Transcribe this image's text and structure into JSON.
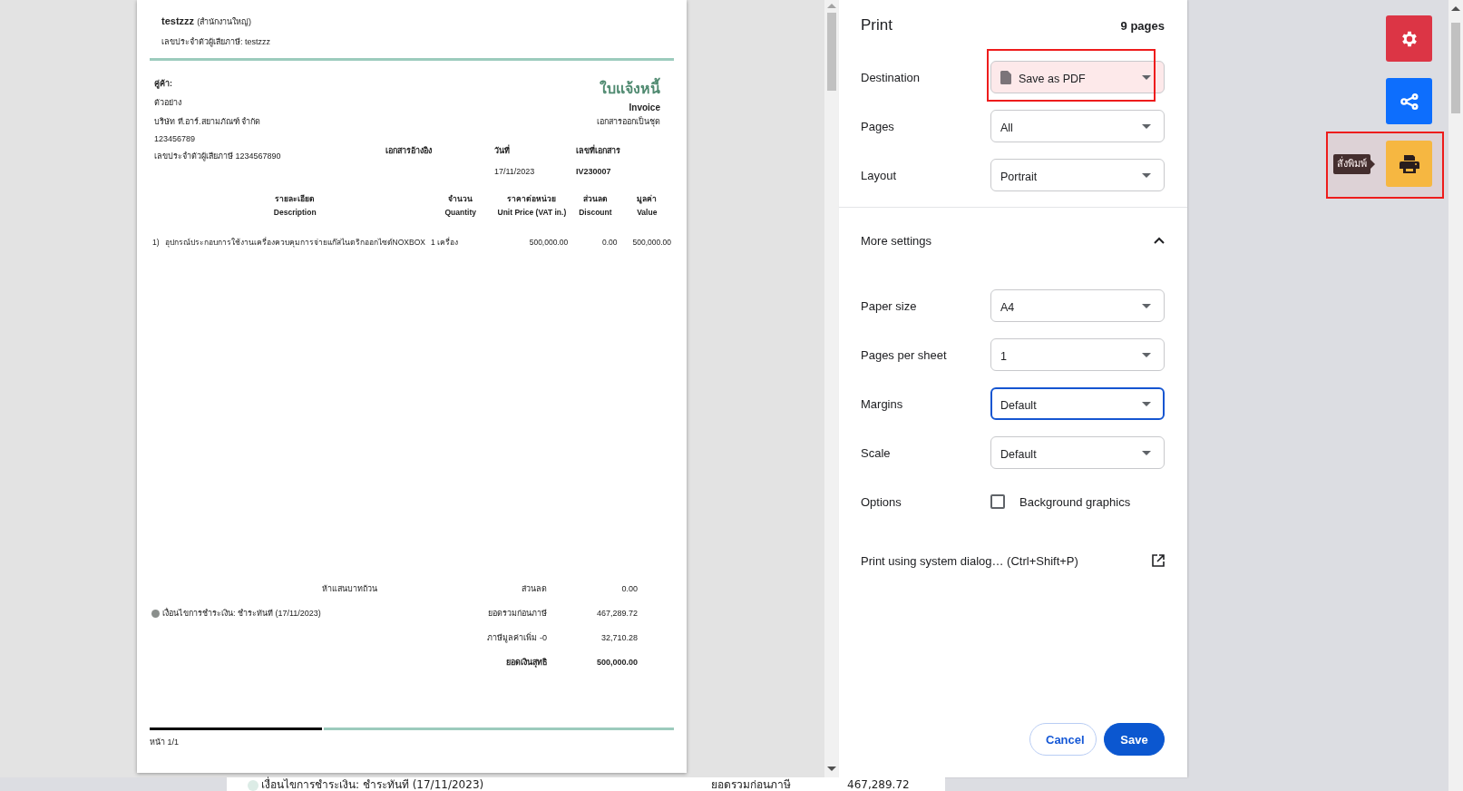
{
  "invoice": {
    "company": "testzzz",
    "branch": "(สำนักงานใหญ่)",
    "company_tax_id": "เลขประจำตัวผู้เสียภาษี: testzzz",
    "customer_label": "คู่ค้า:",
    "customer_lines": [
      "ตัวอย่าง",
      "บริษัท ที.อาร์.สยามภัณฑ์ จำกัด",
      "123456789",
      "เลขประจำตัวผู้เสียภาษี 1234567890"
    ],
    "title_th": "ใบแจ้งหนี้",
    "title_en": "Invoice",
    "subtitle": "เอกสารออกเป็นชุด",
    "meta": [
      {
        "label": "เอกสารอ้างอิง"
      },
      {
        "label": "วันที่",
        "value": "17/11/2023"
      },
      {
        "label": "เลขที่เอกสาร",
        "value": "IV230007"
      }
    ],
    "columns": [
      {
        "th": "รายละเอียด",
        "en": "Description"
      },
      {
        "th": "จำนวน",
        "en": "Quantity"
      },
      {
        "th": "ราคาต่อหน่วย",
        "en": "Unit Price (VAT in.)"
      },
      {
        "th": "ส่วนลด",
        "en": "Discount"
      },
      {
        "th": "มูลค่า",
        "en": "Value"
      }
    ],
    "rows": [
      {
        "no": "1)",
        "description": "อุปกรณ์ประกอบการใช้งานเครื่องควบคุมการจ่ายแก๊สไนตริกออกไซด์NOXBOX",
        "quantity": "1 เครื่อง",
        "unit_price": "500,000.00",
        "discount": "0.00",
        "value": "500,000.00"
      }
    ],
    "amount_words": "ห้าแสนบาทถ้วน",
    "payment_terms": "เงื่อนไขการชำระเงิน: ชำระทันที (17/11/2023)",
    "totals": [
      {
        "label": "ส่วนลด",
        "value": "0.00",
        "bold": false
      },
      {
        "label": "ยอดรวมก่อนภาษี",
        "value": "467,289.72",
        "bold": false
      },
      {
        "label": "ภาษีมูลค่าเพิ่ม -0",
        "value": "32,710.28",
        "bold": false
      },
      {
        "label": "ยอดเงินสุทธิ",
        "value": "500,000.00",
        "bold": true
      }
    ],
    "page_number": "หน้า 1/1"
  },
  "print": {
    "title": "Print",
    "page_count": "9 pages",
    "settings": [
      {
        "kind": "select",
        "label": "Destination",
        "value": "Save as PDF",
        "file_icon": true,
        "focused": false,
        "highlighted": true
      },
      {
        "kind": "select",
        "label": "Pages",
        "value": "All",
        "file_icon": false,
        "focused": false,
        "highlighted": false
      },
      {
        "kind": "select",
        "label": "Layout",
        "value": "Portrait",
        "file_icon": false,
        "focused": false,
        "highlighted": false
      }
    ],
    "more_settings": {
      "label": "More settings",
      "expanded": true
    },
    "more": [
      {
        "kind": "select",
        "label": "Paper size",
        "value": "A4",
        "focused": false
      },
      {
        "kind": "select",
        "label": "Pages per sheet",
        "value": "1",
        "focused": false
      },
      {
        "kind": "select",
        "label": "Margins",
        "value": "Default",
        "focused": true
      },
      {
        "kind": "select",
        "label": "Scale",
        "value": "Default",
        "focused": false
      },
      {
        "kind": "checkbox",
        "label": "Options",
        "value": "Background graphics",
        "checked": false
      }
    ],
    "system_dialog": "Print using system dialog… (Ctrl+Shift+P)",
    "buttons": [
      {
        "label": "Cancel",
        "kind": "secondary"
      },
      {
        "label": "Save",
        "kind": "primary"
      }
    ]
  },
  "side_buttons": [
    {
      "kind": "settings",
      "highlighted": false
    },
    {
      "kind": "share",
      "highlighted": false
    },
    {
      "kind": "print",
      "highlighted": true,
      "tooltip": "สั่งพิมพ์"
    }
  ],
  "background_page": {
    "payment_terms": "เงื่อนไขการชำระเงิน: ชำระทันที (17/11/2023)",
    "total_label": "ยอดรวมก่อนภาษี",
    "total_value": "467,289.72"
  }
}
